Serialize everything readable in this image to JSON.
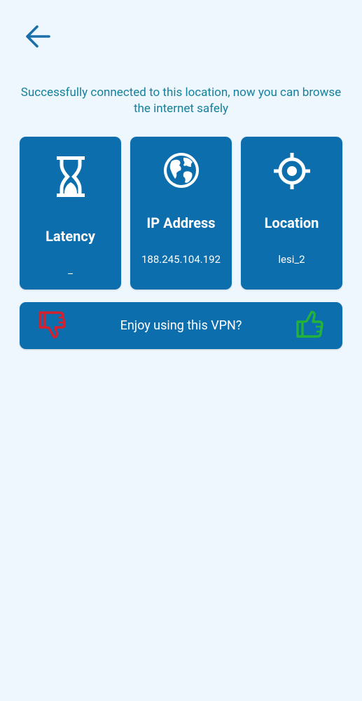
{
  "header": {
    "back_icon": "arrow-left-icon"
  },
  "status": {
    "message": "Successfully connected to this location, now you can browse the internet safely"
  },
  "cards": [
    {
      "id": "latency",
      "title": "Latency",
      "value": "_",
      "icon": "hourglass-icon"
    },
    {
      "id": "ip",
      "title": "IP Address",
      "value": "188.245.104.192",
      "icon": "globe-icon"
    },
    {
      "id": "location",
      "title": "Location",
      "value": "lesi_2",
      "icon": "location-target-icon"
    }
  ],
  "feedback": {
    "question": "Enjoy using this VPN?",
    "dislike_icon": "thumbs-down-icon",
    "like_icon": "thumbs-up-icon"
  },
  "colors": {
    "background": "#EEF6FE",
    "card": "#0D6EAE",
    "message_text": "#15819B",
    "back_arrow": "#1A6FAA",
    "dislike": "#D4212D",
    "like": "#22B33A"
  }
}
